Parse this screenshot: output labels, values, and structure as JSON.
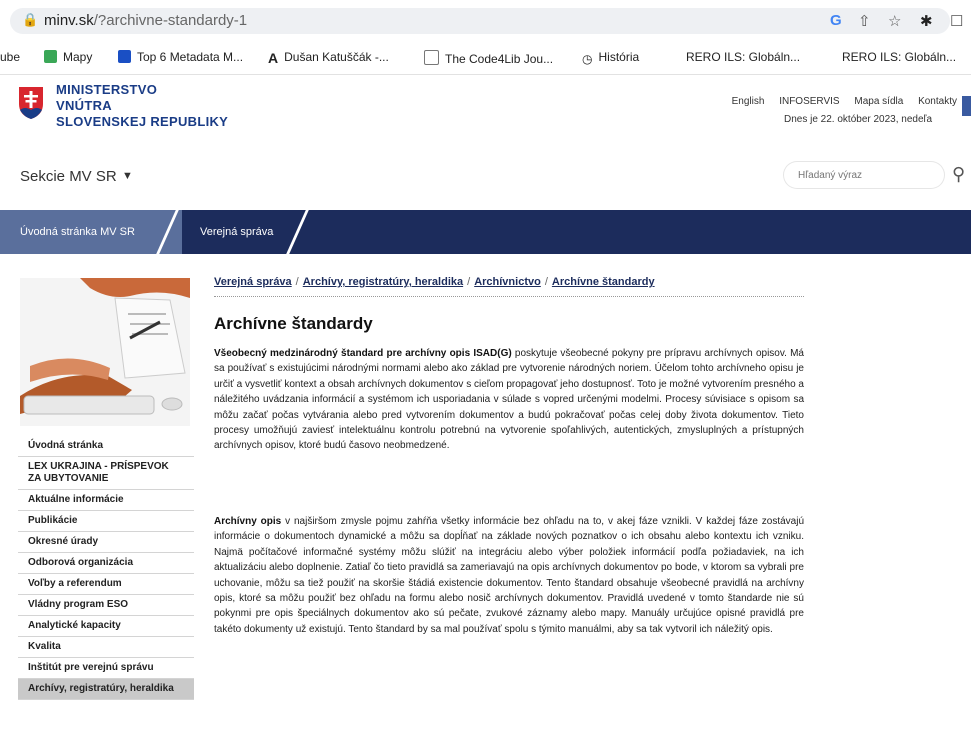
{
  "browser": {
    "url_host": "minv.sk",
    "url_path": "/?archivne-standardy-1",
    "bookmarks": [
      {
        "label": "ube",
        "icon": "youtube-icon"
      },
      {
        "label": "Mapy",
        "icon": "maps-icon"
      },
      {
        "label": "Top 6 Metadata M...",
        "icon": "bookmark-icon"
      },
      {
        "label": "Dušan Katuščák -...",
        "icon": "font-a-icon"
      },
      {
        "label": "The Code4Lib Jou...",
        "icon": "bookmark-icon"
      },
      {
        "label": "História",
        "icon": "history-icon"
      },
      {
        "label": "RERO ILS: Globáln...",
        "icon": "none"
      },
      {
        "label": "RERO ILS: Globáln...",
        "icon": "none"
      }
    ]
  },
  "header": {
    "logo_line1": "MINISTERSTVO",
    "logo_line2": "VNÚTRA",
    "logo_line3": "SLOVENSKEJ REPUBLIKY",
    "links": [
      "English",
      "INFOSERVIS",
      "Mapa sídla",
      "Kontakty"
    ],
    "date_text": "Dnes je 22. október 2023, nedeľa",
    "section_label": "Sekcie MV SR",
    "search_placeholder": "Hľadaný výraz"
  },
  "nav": {
    "home": "Úvodná stránka MV SR",
    "current": "Verejná správa"
  },
  "breadcrumb": {
    "items": [
      "Verejná správa",
      "Archívy, registratúry, heraldika",
      "Archívnictvo",
      "Archívne štandardy"
    ],
    "separator": "/"
  },
  "page_title": "Archívne štandardy",
  "p1_bold": "Všeobecný medzinárodný štandard pre archívny opis ISAD(G)",
  "p1_rest": " poskytuje všeobecné pokyny pre prípravu archívnych opisov. Má sa používať s existujúcimi národnými normami alebo ako základ pre vytvorenie národných noriem. Účelom tohto archívneho opisu je určiť a vysvetliť kontext a obsah archívnych dokumentov s cieľom propagovať jeho dostupnosť. Toto je možné vytvorením presného a náležitého uvádzania informácií a systémom ich usporiadania v súlade s vopred určenými modelmi. Procesy súvisiace s opisom sa môžu začať počas vytvárania alebo pred vytvorením dokumentov a budú pokračovať počas celej doby života dokumentov. Tieto procesy umožňujú zaviesť intelektuálnu kontrolu potrebnú na vytvorenie spoľahlivých, autentických, zmysluplných a prístupných archívnych opisov, ktoré budú časovo neobmedzené.",
  "p2_bold": "Archívny opis",
  "p2_rest": " v najširšom zmysle pojmu zahŕňa všetky informácie bez ohľadu na to, v akej fáze vznikli. V každej fáze zostávajú informácie o dokumentoch dynamické a môžu sa dopĺňať na základe nových poznatkov o ich obsahu alebo kontextu ich vzniku. Najmä počítačové informačné systémy môžu slúžiť na integráciu alebo výber položiek informácií podľa požiadaviek, na ich aktualizáciu alebo doplnenie. Zatiaľ čo tieto pravidlá sa zameriavajú na opis archívnych dokumentov po bode, v ktorom sa vybrali pre uchovanie, môžu sa tiež použiť na skoršie štádiá existencie dokumentov. Tento štandard obsahuje všeobecné pravidlá na archívny opis, ktoré sa môžu použiť bez ohľadu na formu alebo nosič archívnych dokumentov. Pravidlá uvedené v tomto štandarde nie sú pokynmi pre opis špeciálnych dokumentov ako sú pečate, zvukové záznamy alebo mapy. Manuály určujúce opisné pravidlá pre takéto dokumenty už existujú. Tento štandard by sa mal používať spolu s týmito manuálmi, aby sa tak vytvoril ich náležitý opis.",
  "menu": [
    "Úvodná stránka",
    "LEX UKRAJINA - PRÍSPEVOK ZA UBYTOVANIE",
    "Aktuálne informácie",
    "Publikácie",
    "Okresné úrady",
    "Odborová organizácia",
    "Voľby a referendum",
    "Vládny program ESO",
    "Analytické kapacity",
    "Kvalita",
    "Inštitút pre verejnú správu",
    "Archívy, registratúry, heraldika"
  ],
  "colors": {
    "nav_dark": "#1c2c5c",
    "nav_home": "#5a6f9c",
    "logo_blue": "#1a3c86",
    "menu_active": "#c9c9c9"
  }
}
